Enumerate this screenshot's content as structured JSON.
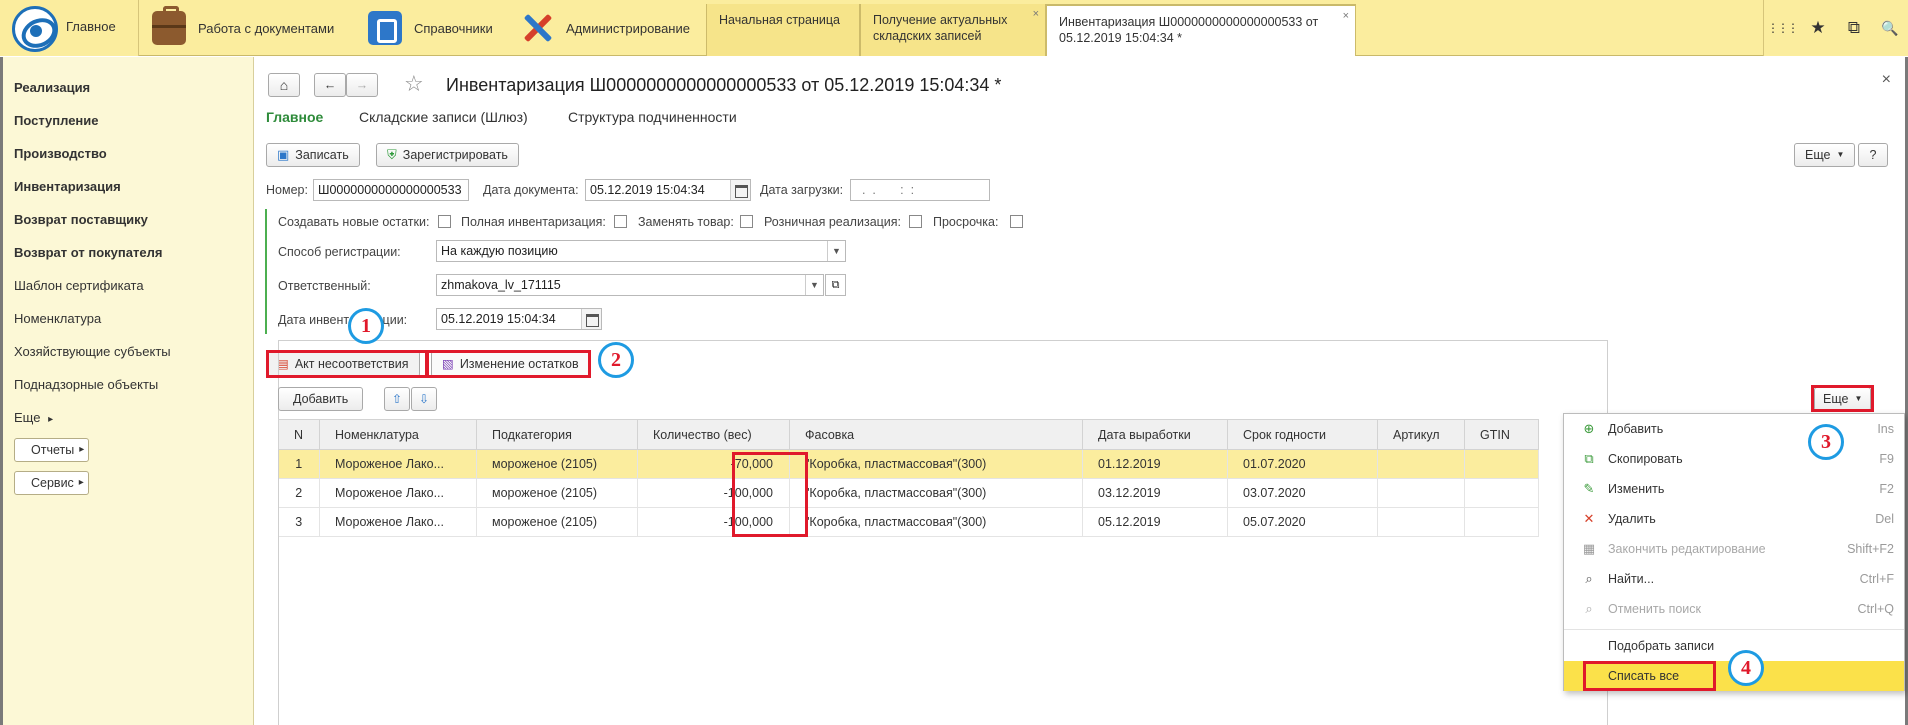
{
  "topbar": {
    "home_tab": "Главное",
    "nav": [
      "Работа с документами",
      "Справочники",
      "Администрирование"
    ],
    "open_tabs": [
      {
        "label": "Начальная страница"
      },
      {
        "label": "Получение актуальных складских записей"
      },
      {
        "label": "Инвентаризация Ш0000000000000000533 от 05.12.2019 15:04:34 *"
      }
    ],
    "close_glyph": "×",
    "right_icons": [
      "⋮⋮⋮",
      "★",
      "⧉",
      "🔍"
    ]
  },
  "sidebar": {
    "items": [
      "Реализация",
      "Поступление",
      "Производство",
      "Инвентаризация",
      "Возврат поставщику",
      "Возврат от покупателя",
      "Шаблон сертификата",
      "Номенклатура",
      "Хозяйствующие субъекты",
      "Поднадзорные объекты",
      "Еще"
    ],
    "more_arrow": "▸",
    "buttons": [
      "Отчеты",
      "Сервис"
    ]
  },
  "form": {
    "title": "Инвентаризация Ш0000000000000000533 от 05.12.2019 15:04:34 *",
    "close": "×",
    "tabs": [
      "Главное",
      "Складские записи (Шлюз)",
      "Структура подчиненности"
    ],
    "toolbar": {
      "save": "Записать",
      "register": "Зарегистрировать",
      "more": "Еще",
      "help": "?"
    },
    "fields": {
      "number_label": "Номер:",
      "number_value": "Ш0000000000000000533",
      "doc_date_label": "Дата документа:",
      "doc_date_value": "05.12.2019 15:04:34",
      "load_date_label": "Дата загрузки:",
      "load_date_value": "  .  .       :  :",
      "create_new_label": "Создавать новые остатки:",
      "full_inv_label": "Полная инвентаризация:",
      "replace_label": "Заменять товар:",
      "retail_label": "Розничная реализация:",
      "overdue_label": "Просрочка:",
      "reg_method_label": "Способ регистрации:",
      "reg_method_value": "На каждую позицию",
      "responsible_label": "Ответственный:",
      "responsible_value": "zhmakova_lv_171115",
      "inv_date_label": "Дата инвентаризации:",
      "inv_date_value": "05.12.2019 15:04:34"
    },
    "subtabs": [
      "Акт несоответствия",
      "Изменение остатков"
    ],
    "table_toolbar": {
      "add": "Добавить",
      "up": "⇧",
      "down": "⇩",
      "more": "Еще"
    },
    "table": {
      "columns": [
        "N",
        "Номенклатура",
        "Подкатегория",
        "Количество (вес)",
        "Фасовка",
        "Дата выработки",
        "Срок годности",
        "Артикул",
        "GTIN"
      ],
      "rows": [
        [
          "1",
          "Мороженое Лако...",
          "мороженое (2105)",
          "-70,000",
          "\"Коробка, пластмассовая\"(300)",
          "01.12.2019",
          "01.07.2020",
          "",
          ""
        ],
        [
          "2",
          "Мороженое Лако...",
          "мороженое (2105)",
          "-100,000",
          "\"Коробка, пластмассовая\"(300)",
          "03.12.2019",
          "03.07.2020",
          "",
          ""
        ],
        [
          "3",
          "Мороженое Лако...",
          "мороженое (2105)",
          "-100,000",
          "\"Коробка, пластмассовая\"(300)",
          "05.12.2019",
          "05.07.2020",
          "",
          ""
        ]
      ]
    }
  },
  "menu": {
    "items": [
      {
        "label": "Добавить",
        "key": "Ins",
        "icon": "⊕",
        "color": "#3a9a3a"
      },
      {
        "label": "Скопировать",
        "key": "F9",
        "icon": "⧉",
        "color": "#3a9a3a"
      },
      {
        "label": "Изменить",
        "key": "F2",
        "icon": "✎",
        "color": "#3a9a3a"
      },
      {
        "label": "Удалить",
        "key": "Del",
        "icon": "✕",
        "color": "#d6402a"
      },
      {
        "label": "Закончить редактирование",
        "key": "Shift+F2",
        "icon": "▦",
        "color": "#9a9a9a"
      },
      {
        "label": "Найти...",
        "key": "Ctrl+F",
        "icon": "⌕",
        "color": "#555555"
      },
      {
        "label": "Отменить поиск",
        "key": "Ctrl+Q",
        "icon": "⌕",
        "color": "#aaaaaa"
      },
      {
        "label": "Подобрать записи",
        "key": "",
        "icon": "",
        "color": ""
      },
      {
        "label": "Списать все",
        "key": "",
        "icon": "",
        "color": ""
      }
    ]
  },
  "annotations": [
    "1",
    "2",
    "3",
    "4"
  ],
  "colors": {
    "accent_yellow": "#fbed9e",
    "highlight_red": "#e0192b",
    "badge_blue": "#1e9be2",
    "active_tab_green": "#2e8b3a"
  }
}
